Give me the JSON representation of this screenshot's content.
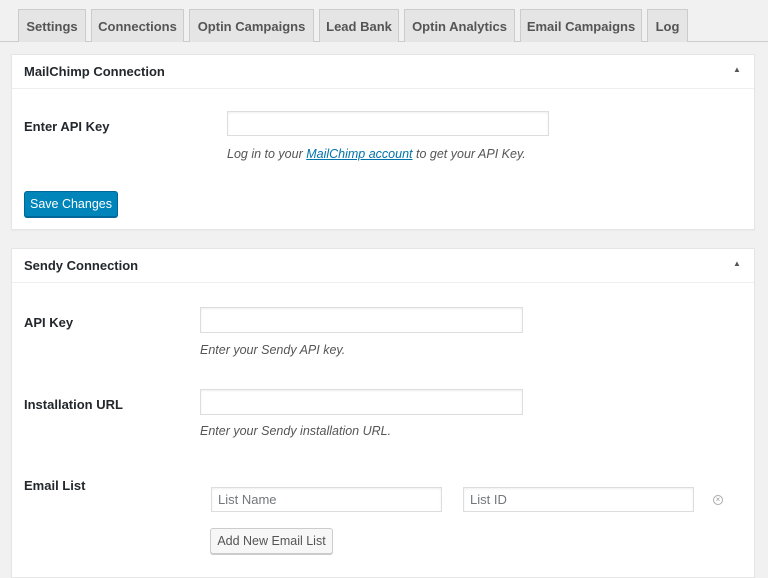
{
  "tabs": [
    {
      "label": "Settings"
    },
    {
      "label": "Connections"
    },
    {
      "label": "Optin Campaigns"
    },
    {
      "label": "Lead Bank"
    },
    {
      "label": "Optin Analytics"
    },
    {
      "label": "Email Campaigns"
    },
    {
      "label": "Log"
    }
  ],
  "mailchimp": {
    "title": "MailChimp Connection",
    "toggle_icon": "▲",
    "api_key_label": "Enter API Key",
    "api_key_value": "",
    "help_prefix": "Log in to your ",
    "help_link": "MailChimp account",
    "help_suffix": " to get your API Key.",
    "save_label": "Save Changes"
  },
  "sendy": {
    "title": "Sendy Connection",
    "toggle_icon": "▲",
    "api_key_label": "API Key",
    "api_key_value": "",
    "api_key_help": "Enter your Sendy API key.",
    "url_label": "Installation URL",
    "url_value": "",
    "url_help": "Enter your Sendy installation URL.",
    "email_list_label": "Email List",
    "list_name_placeholder": "List Name",
    "list_id_placeholder": "List ID",
    "remove_icon": "×",
    "add_list_label": "Add New Email List"
  },
  "colors": {
    "primary_button": "#0085ba",
    "link": "#0073aa",
    "background": "#f1f1f1"
  }
}
